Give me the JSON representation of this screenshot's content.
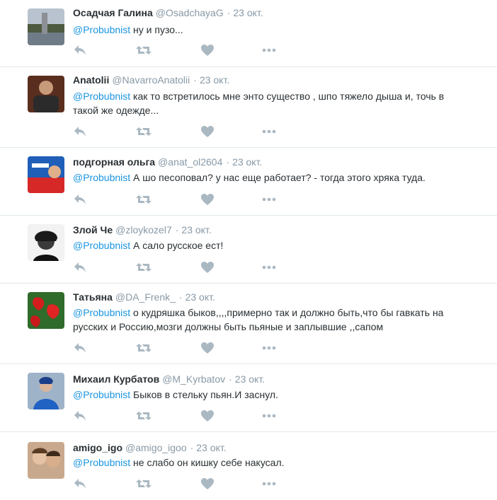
{
  "tweets": [
    {
      "name": "Осадчая Галина",
      "handle": "@OsadchayaG",
      "time": "23 окт.",
      "mention": "@Probubnist",
      "text": " ну и пузо...",
      "avatar": "landscape-photo"
    },
    {
      "name": "Anatolii",
      "handle": "@NavarroAnatolii",
      "time": "23 окт.",
      "mention": "@Probubnist",
      "text": " как то встретилось мне энто существо , шпо тяжело дыша и, точь в такой же одежде...",
      "avatar": "man-in-dark-shirt-photo"
    },
    {
      "name": "подгорная ольга",
      "handle": "@anat_ol2604",
      "time": "23 окт.",
      "mention": "@Probubnist",
      "text": " А шо песоповал? у нас еще работает? - тогда этого хряка туда.",
      "avatar": "united-russia-logo-photo"
    },
    {
      "name": "Злой Че",
      "handle": "@zloykozel7",
      "time": "23 окт.",
      "mention": "@Probubnist",
      "text": " А сало русское ест!",
      "avatar": "che-guevara-portrait"
    },
    {
      "name": "Татьяна",
      "handle": "@DA_Frenk_",
      "time": "23 окт.",
      "mention": "@Probubnist",
      "text": " о кудряшка быков,,,,примерно так и должно быть,что бы гавкать на русских и Россию,мозги должны быть пьяные и заплывшие ,,сапом",
      "avatar": "red-anthurium-flowers"
    },
    {
      "name": "Михаил Курбатов",
      "handle": "@M_Kyrbatov",
      "time": "23 окт.",
      "mention": "@Probubnist",
      "text": " Быков в стельку пьян.И заснул.",
      "avatar": "person-in-blue-jacket-photo"
    },
    {
      "name": "amigo_igo",
      "handle": "@amigo_igoo",
      "time": "23 окт.",
      "mention": "@Probubnist",
      "text": " не слабо он кишку себе накусал.",
      "avatar": "couple-photo"
    }
  ],
  "icons": {
    "reply": "reply-icon",
    "retweet": "retweet-icon",
    "like": "heart-icon",
    "more": "more-icon"
  },
  "colors": {
    "mention": "#1b95e0",
    "meta": "#8899a6",
    "action_icon": "#aab8c2",
    "divider": "#e1e8ed"
  }
}
